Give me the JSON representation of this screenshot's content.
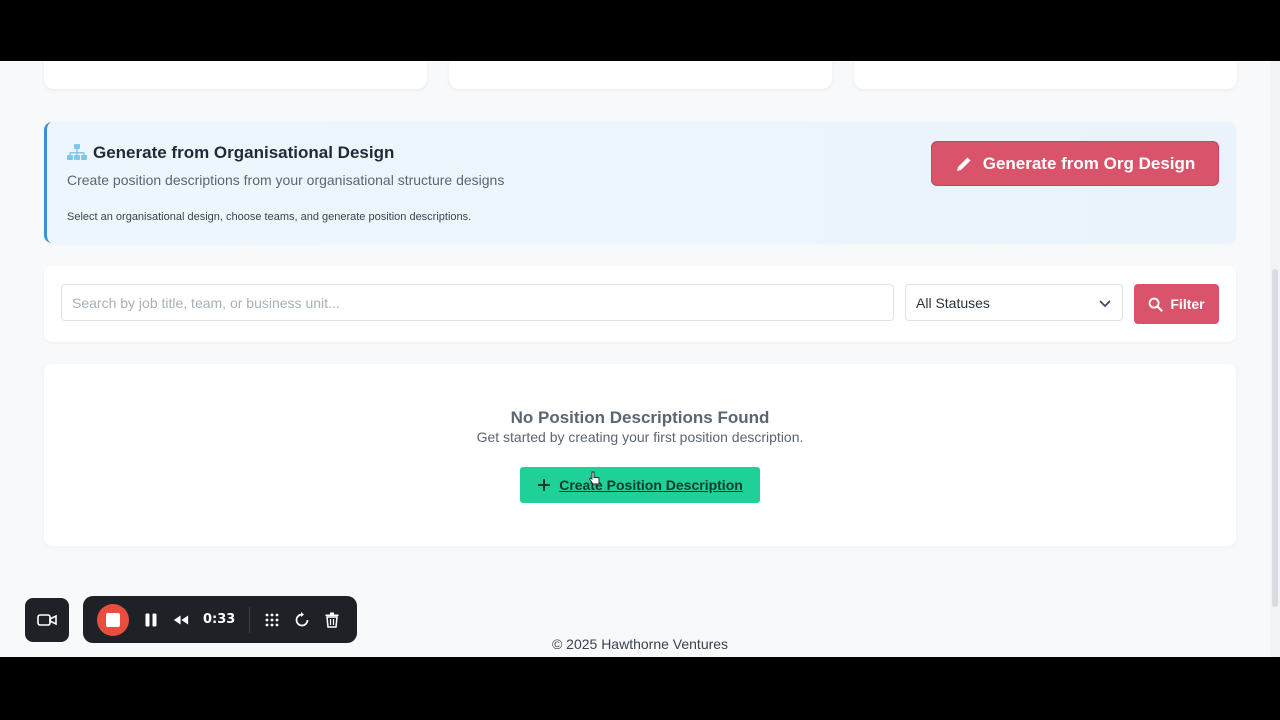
{
  "org_design": {
    "title": "Generate from Organisational Design",
    "subtitle": "Create position descriptions from your organisational structure designs",
    "hint": "Select an organisational design, choose teams, and generate position descriptions.",
    "button_label": "Generate from Org Design",
    "icon": "sitemap-icon",
    "icon_color": "#7fc6e8"
  },
  "filters": {
    "search_placeholder": "Search by job title, team, or business unit...",
    "search_value": "",
    "status_selected": "All Statuses",
    "filter_label": "Filter"
  },
  "empty_state": {
    "title": "No Position Descriptions Found",
    "subtitle": "Get started by creating your first position description.",
    "create_label": "Create Position Description"
  },
  "footer": {
    "copyright": "© 2025 Hawthorne Ventures"
  },
  "recorder": {
    "elapsed": "0:33"
  },
  "colors": {
    "primary": "#d9536a",
    "success": "#1fd198",
    "banner_border": "#3b8fd9",
    "record": "#e94d3d"
  }
}
